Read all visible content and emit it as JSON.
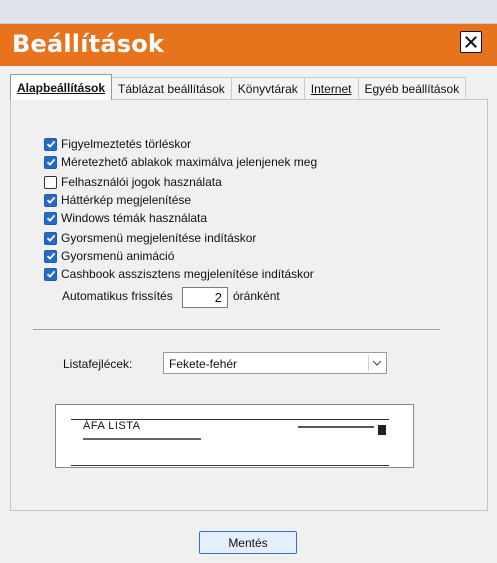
{
  "window": {
    "title": "Beállítások",
    "title_bar_color": "#e8731d",
    "close_icon": "close-icon"
  },
  "tabs": [
    {
      "label": "Alapbeállítások",
      "active": true
    },
    {
      "label": "Táblázat beállítások",
      "active": false
    },
    {
      "label": "Könyvtárak",
      "active": false
    },
    {
      "label": "Internet",
      "active": false
    },
    {
      "label": "Egyéb beállítások",
      "active": false
    }
  ],
  "options": [
    {
      "label": "Figyelmeztetés törléskor",
      "checked": true
    },
    {
      "label": "Méretezhető ablakok maximálva jelenjenek meg",
      "checked": true
    },
    {
      "label": "Felhasználói jogok használata",
      "checked": false
    },
    {
      "label": "Háttérkép megjelenítése",
      "checked": true
    },
    {
      "label": "Windows témák használata",
      "checked": true
    },
    {
      "label": "Gyorsmenü megjelenítése indításkor",
      "checked": true
    },
    {
      "label": "Gyorsmenü animáció",
      "checked": true
    },
    {
      "label": "Cashbook asszisztens megjelenítése indításkor",
      "checked": true
    }
  ],
  "refresh": {
    "label": "Automatikus frissítés",
    "value": "2",
    "unit": "óránként"
  },
  "list_header": {
    "label": "Listafejlécek:",
    "selected": "Fekete-fehér"
  },
  "preview": {
    "title": "ÁFA LISTA"
  },
  "save_button": {
    "label": "Mentés"
  },
  "accent_color": "#2468c8"
}
